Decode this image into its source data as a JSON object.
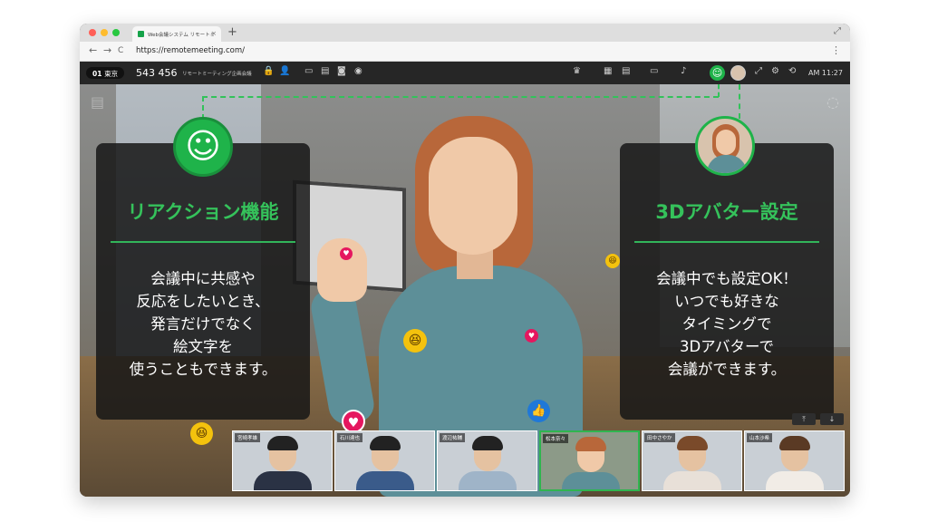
{
  "browser": {
    "tab_title": "Web会議システム リモートミ",
    "tab_close": "×",
    "new_tab": "+",
    "url": "https://remotemeeting.com/",
    "nav_back": "←",
    "nav_forward": "→",
    "nav_reload": "C",
    "menu": "⋮",
    "expand": "⤢"
  },
  "app": {
    "room_num": "01",
    "room_name": "東京",
    "meeting_id": "543 456",
    "meeting_name": "リモートミーティング企画会議",
    "time": "AM 11:27",
    "react_icon": "☺"
  },
  "cards": {
    "left_title": "リアクション機能",
    "left_lines": [
      "会議中に共感や",
      "反応をしたいとき、",
      "発言だけでなく",
      "絵文字を",
      "使うこともできます。"
    ],
    "right_title": "3Dアバター設定",
    "right_lines": [
      "会議中でも設定OK！",
      "いつでも好きな",
      "タイミングで",
      "3Dアバターで",
      "会議ができます。"
    ]
  },
  "reaction_bubble_icon": "☺",
  "emojis": {
    "heart": "♥",
    "laugh": "😆",
    "like": "👍"
  },
  "controls": {
    "share_icon": "⤒",
    "download_icon": "↓"
  },
  "participants": [
    {
      "label": "宮崎孝雄"
    },
    {
      "label": "石川達也"
    },
    {
      "label": "渡辺祐輔"
    },
    {
      "label": "松本奈々"
    },
    {
      "label": "田中さやか"
    },
    {
      "label": "山本沙希"
    }
  ],
  "icons": [
    "crown-icon",
    "layout-icon",
    "tile-icon",
    "camera-icon",
    "mic-icon",
    "reaction-icon",
    "avatar-icon",
    "fullscreen-icon",
    "settings-icon",
    "exit-icon"
  ]
}
